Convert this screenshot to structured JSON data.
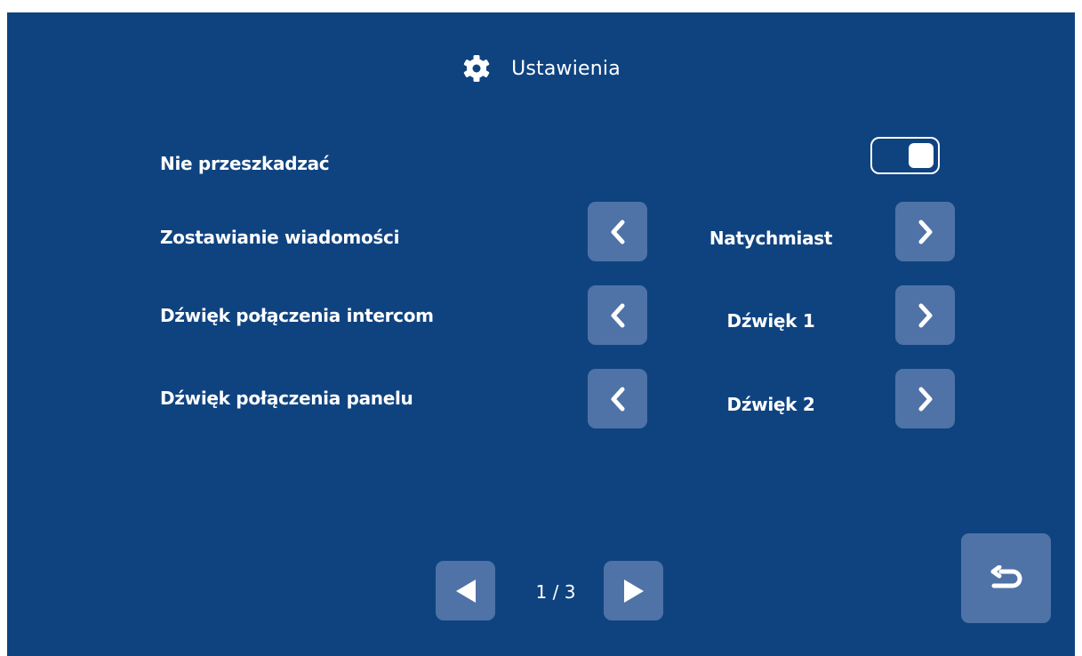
{
  "header": {
    "icon": "gear-icon",
    "title": "Ustawienia"
  },
  "settings": [
    {
      "label": "Nie przeszkadzać",
      "control": "toggle",
      "enabled": true
    },
    {
      "label": "Zostawianie wiadomości",
      "control": "selector",
      "value": "Natychmiast"
    },
    {
      "label": "Dźwięk połączenia intercom",
      "control": "selector",
      "value": "Dźwięk 1"
    },
    {
      "label": "Dźwięk połączenia panelu",
      "control": "selector",
      "value": "Dźwięk 2"
    }
  ],
  "pagination": {
    "indicator": "1 / 3",
    "current_page": 1,
    "total_pages": 3
  },
  "icons": {
    "prev_option": "chevron-left-icon",
    "next_option": "chevron-right-icon",
    "prev_page": "triangle-left-icon",
    "next_page": "triangle-right-icon",
    "back": "return-icon"
  },
  "colors": {
    "background": "#0f4380",
    "button": "#4f73a6",
    "text": "#ffffff"
  }
}
